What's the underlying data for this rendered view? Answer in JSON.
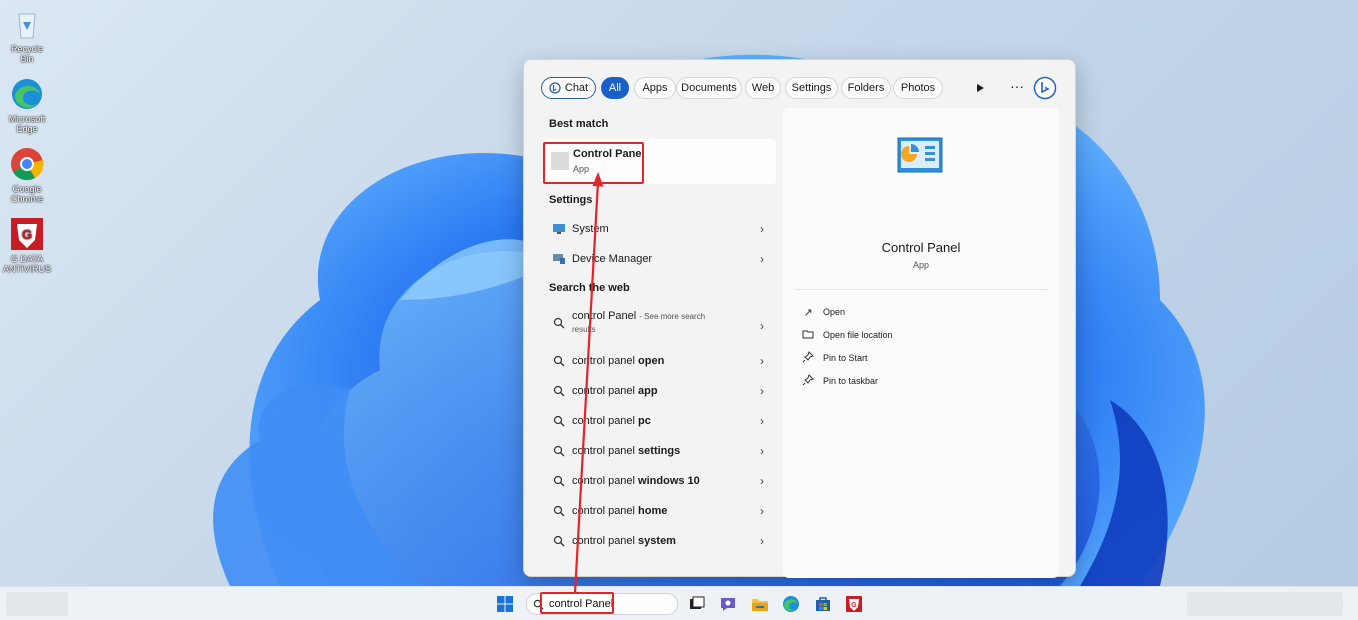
{
  "desktop": {
    "icons": [
      {
        "label": "Recycle Bin",
        "icon": "recycle-bin-icon"
      },
      {
        "label": "Microsoft Edge",
        "icon": "edge-icon"
      },
      {
        "label": "Google Chrome",
        "icon": "chrome-icon"
      },
      {
        "label": "G DATA ANTIVIRUS",
        "icon": "gdata-icon"
      }
    ]
  },
  "search": {
    "filters": [
      "Chat",
      "All",
      "Apps",
      "Documents",
      "Web",
      "Settings",
      "Folders",
      "Photos"
    ],
    "active_filter": "All",
    "best_match_heading": "Best match",
    "best_match": {
      "title": "Control Panel",
      "subtitle": "App"
    },
    "settings_heading": "Settings",
    "settings_items": [
      "System",
      "Device Manager"
    ],
    "web_heading": "Search the web",
    "web_first": {
      "query": "control Panel",
      "suffix": "- See more search",
      "suffix2": "results"
    },
    "web_suggestions": [
      {
        "prefix": "control panel ",
        "bold": "open"
      },
      {
        "prefix": "control panel ",
        "bold": "app"
      },
      {
        "prefix": "control panel ",
        "bold": "pc"
      },
      {
        "prefix": "control panel ",
        "bold": "settings"
      },
      {
        "prefix": "control panel ",
        "bold": "windows 10"
      },
      {
        "prefix": "control panel ",
        "bold": "home"
      },
      {
        "prefix": "control panel ",
        "bold": "system"
      }
    ],
    "preview": {
      "title": "Control Panel",
      "subtitle": "App",
      "actions": [
        "Open",
        "Open file location",
        "Pin to Start",
        "Pin to taskbar"
      ]
    }
  },
  "taskbar": {
    "search_text": "control Panel"
  },
  "colors": {
    "accent": "#1760c7",
    "annotation_red": "#e0252b"
  }
}
